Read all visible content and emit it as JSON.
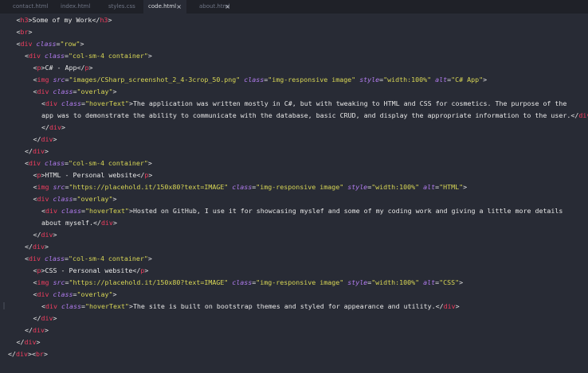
{
  "tabs": [
    {
      "label": "contact.html",
      "active": false
    },
    {
      "label": "index.html",
      "active": false
    },
    {
      "label": "styles.css",
      "active": false
    },
    {
      "label": "code.html",
      "active": true
    },
    {
      "label": "about.html",
      "active": false
    }
  ],
  "close_glyph": "×",
  "code_lines": [
    {
      "indent": 1,
      "tokens": [
        [
          "t",
          "<"
        ],
        [
          "tg",
          "h3"
        ],
        [
          "t",
          ">"
        ],
        [
          "tx",
          "Some of my Work"
        ],
        [
          "t",
          "</"
        ],
        [
          "tg",
          "h3"
        ],
        [
          "t",
          ">"
        ]
      ]
    },
    {
      "indent": 1,
      "tokens": [
        [
          "t",
          "<"
        ],
        [
          "tg",
          "br"
        ],
        [
          "t",
          ">"
        ]
      ]
    },
    {
      "indent": 1,
      "tokens": [
        [
          "t",
          "<"
        ],
        [
          "tg",
          "div"
        ],
        [
          "t",
          " "
        ],
        [
          "at",
          "class"
        ],
        [
          "eq",
          "="
        ],
        [
          "st",
          "\"row\""
        ],
        [
          "t",
          ">"
        ]
      ]
    },
    {
      "indent": 2,
      "tokens": [
        [
          "t",
          "<"
        ],
        [
          "tg",
          "div"
        ],
        [
          "t",
          " "
        ],
        [
          "at",
          "class"
        ],
        [
          "eq",
          "="
        ],
        [
          "st",
          "\"col-sm-4 container\""
        ],
        [
          "t",
          ">"
        ]
      ]
    },
    {
      "indent": 3,
      "tokens": [
        [
          "t",
          "<"
        ],
        [
          "tg",
          "p"
        ],
        [
          "t",
          ">"
        ],
        [
          "tx",
          "C# - App"
        ],
        [
          "t",
          "</"
        ],
        [
          "tg",
          "p"
        ],
        [
          "t",
          ">"
        ]
      ]
    },
    {
      "indent": 3,
      "tokens": [
        [
          "t",
          "<"
        ],
        [
          "tg",
          "img"
        ],
        [
          "t",
          " "
        ],
        [
          "at",
          "src"
        ],
        [
          "eq",
          "="
        ],
        [
          "st",
          "\"images/CSharp_screenshot_2_4-3crop_50.png\""
        ],
        [
          "t",
          " "
        ],
        [
          "at",
          "class"
        ],
        [
          "eq",
          "="
        ],
        [
          "st",
          "\"img-responsive image\""
        ],
        [
          "t",
          " "
        ],
        [
          "at",
          "style"
        ],
        [
          "eq",
          "="
        ],
        [
          "st",
          "\"width:100%\""
        ],
        [
          "t",
          " "
        ],
        [
          "at",
          "alt"
        ],
        [
          "eq",
          "="
        ],
        [
          "st",
          "\"C# App\""
        ],
        [
          "t",
          ">"
        ]
      ]
    },
    {
      "indent": 3,
      "tokens": [
        [
          "t",
          "<"
        ],
        [
          "tg",
          "div"
        ],
        [
          "t",
          " "
        ],
        [
          "at",
          "class"
        ],
        [
          "eq",
          "="
        ],
        [
          "st",
          "\"overlay\""
        ],
        [
          "t",
          ">"
        ]
      ]
    },
    {
      "indent": 4,
      "tokens": [
        [
          "t",
          "<"
        ],
        [
          "tg",
          "div"
        ],
        [
          "t",
          " "
        ],
        [
          "at",
          "class"
        ],
        [
          "eq",
          "="
        ],
        [
          "st",
          "\"hoverText\""
        ],
        [
          "t",
          ">"
        ],
        [
          "tx",
          "The application was written mostly in C#, but with tweaking to HTML and CSS for cosmetics. The purpose of the"
        ]
      ]
    },
    {
      "indent": 4,
      "tokens": [
        [
          "tx",
          "app was to demonstrate the ability to communicate with the database, basic CRUD, and display the appropriate information to the user."
        ],
        [
          "t",
          "</"
        ],
        [
          "tg",
          "div"
        ],
        [
          "t",
          ">"
        ]
      ]
    },
    {
      "indent": 4,
      "tokens": [
        [
          "t",
          "</"
        ],
        [
          "tg",
          "div"
        ],
        [
          "t",
          ">"
        ]
      ]
    },
    {
      "indent": 3,
      "tokens": [
        [
          "t",
          "</"
        ],
        [
          "tg",
          "div"
        ],
        [
          "t",
          ">"
        ]
      ]
    },
    {
      "indent": 2,
      "tokens": [
        [
          "t",
          "</"
        ],
        [
          "tg",
          "div"
        ],
        [
          "t",
          ">"
        ]
      ]
    },
    {
      "indent": 2,
      "tokens": [
        [
          "t",
          "<"
        ],
        [
          "tg",
          "div"
        ],
        [
          "t",
          " "
        ],
        [
          "at",
          "class"
        ],
        [
          "eq",
          "="
        ],
        [
          "st",
          "\"col-sm-4 container\""
        ],
        [
          "t",
          ">"
        ]
      ]
    },
    {
      "indent": 3,
      "tokens": [
        [
          "t",
          "<"
        ],
        [
          "tg",
          "p"
        ],
        [
          "t",
          ">"
        ],
        [
          "tx",
          "HTML - Personal website"
        ],
        [
          "t",
          "</"
        ],
        [
          "tg",
          "p"
        ],
        [
          "t",
          ">"
        ]
      ]
    },
    {
      "indent": 3,
      "tokens": [
        [
          "t",
          "<"
        ],
        [
          "tg",
          "img"
        ],
        [
          "t",
          " "
        ],
        [
          "at",
          "src"
        ],
        [
          "eq",
          "="
        ],
        [
          "st",
          "\"https://placehold.it/150x80?text=IMAGE\""
        ],
        [
          "t",
          " "
        ],
        [
          "at",
          "class"
        ],
        [
          "eq",
          "="
        ],
        [
          "st",
          "\"img-responsive image\""
        ],
        [
          "t",
          " "
        ],
        [
          "at",
          "style"
        ],
        [
          "eq",
          "="
        ],
        [
          "st",
          "\"width:100%\""
        ],
        [
          "t",
          " "
        ],
        [
          "at",
          "alt"
        ],
        [
          "eq",
          "="
        ],
        [
          "st",
          "\"HTML\""
        ],
        [
          "t",
          ">"
        ]
      ]
    },
    {
      "indent": 3,
      "tokens": [
        [
          "t",
          "<"
        ],
        [
          "tg",
          "div"
        ],
        [
          "t",
          " "
        ],
        [
          "at",
          "class"
        ],
        [
          "eq",
          "="
        ],
        [
          "st",
          "\"overlay\""
        ],
        [
          "t",
          ">"
        ]
      ]
    },
    {
      "indent": 4,
      "tokens": [
        [
          "t",
          "<"
        ],
        [
          "tg",
          "div"
        ],
        [
          "t",
          " "
        ],
        [
          "at",
          "class"
        ],
        [
          "eq",
          "="
        ],
        [
          "st",
          "\"hoverText\""
        ],
        [
          "t",
          ">"
        ],
        [
          "tx",
          "Hosted on GitHub, I use it for showcasing myslef and some of my coding work and giving a little more details"
        ]
      ]
    },
    {
      "indent": 4,
      "tokens": [
        [
          "tx",
          "about myself."
        ],
        [
          "t",
          "</"
        ],
        [
          "tg",
          "div"
        ],
        [
          "t",
          ">"
        ]
      ]
    },
    {
      "indent": 3,
      "tokens": [
        [
          "t",
          "</"
        ],
        [
          "tg",
          "div"
        ],
        [
          "t",
          ">"
        ]
      ]
    },
    {
      "indent": 2,
      "tokens": [
        [
          "t",
          "</"
        ],
        [
          "tg",
          "div"
        ],
        [
          "t",
          ">"
        ]
      ]
    },
    {
      "indent": 2,
      "tokens": [
        [
          "t",
          "<"
        ],
        [
          "tg",
          "div"
        ],
        [
          "t",
          " "
        ],
        [
          "at",
          "class"
        ],
        [
          "eq",
          "="
        ],
        [
          "st",
          "\"col-sm-4 container\""
        ],
        [
          "t",
          ">"
        ]
      ]
    },
    {
      "indent": 3,
      "tokens": [
        [
          "t",
          "<"
        ],
        [
          "tg",
          "p"
        ],
        [
          "t",
          ">"
        ],
        [
          "tx",
          "CSS - Personal website"
        ],
        [
          "t",
          "</"
        ],
        [
          "tg",
          "p"
        ],
        [
          "t",
          ">"
        ]
      ]
    },
    {
      "indent": 3,
      "tokens": [
        [
          "t",
          "<"
        ],
        [
          "tg",
          "img"
        ],
        [
          "t",
          " "
        ],
        [
          "at",
          "src"
        ],
        [
          "eq",
          "="
        ],
        [
          "st",
          "\"https://placehold.it/150x80?text=IMAGE\""
        ],
        [
          "t",
          " "
        ],
        [
          "at",
          "class"
        ],
        [
          "eq",
          "="
        ],
        [
          "st",
          "\"img-responsive image\""
        ],
        [
          "t",
          " "
        ],
        [
          "at",
          "style"
        ],
        [
          "eq",
          "="
        ],
        [
          "st",
          "\"width:100%\""
        ],
        [
          "t",
          " "
        ],
        [
          "at",
          "alt"
        ],
        [
          "eq",
          "="
        ],
        [
          "st",
          "\"CSS\""
        ],
        [
          "t",
          ">"
        ]
      ]
    },
    {
      "indent": 3,
      "tokens": [
        [
          "t",
          "<"
        ],
        [
          "tg",
          "div"
        ],
        [
          "t",
          " "
        ],
        [
          "at",
          "class"
        ],
        [
          "eq",
          "="
        ],
        [
          "st",
          "\"overlay\""
        ],
        [
          "t",
          ">"
        ]
      ]
    },
    {
      "indent": 4,
      "tokens": [
        [
          "t",
          "<"
        ],
        [
          "tg",
          "div"
        ],
        [
          "t",
          " "
        ],
        [
          "at",
          "class"
        ],
        [
          "eq",
          "="
        ],
        [
          "st",
          "\"hoverText\""
        ],
        [
          "t",
          ">"
        ],
        [
          "tx",
          "The site is built on bootstrap themes and styled for appearance and utility."
        ],
        [
          "t",
          "</"
        ],
        [
          "tg",
          "div"
        ],
        [
          "t",
          ">"
        ]
      ]
    },
    {
      "indent": 3,
      "tokens": [
        [
          "t",
          "</"
        ],
        [
          "tg",
          "div"
        ],
        [
          "t",
          ">"
        ]
      ]
    },
    {
      "indent": 2,
      "tokens": [
        [
          "t",
          "</"
        ],
        [
          "tg",
          "div"
        ],
        [
          "t",
          ">"
        ]
      ]
    },
    {
      "indent": 1,
      "tokens": [
        [
          "t",
          "</"
        ],
        [
          "tg",
          "div"
        ],
        [
          "t",
          ">"
        ]
      ]
    },
    {
      "indent": 0,
      "tokens": [
        [
          "t",
          "</"
        ],
        [
          "tg",
          "div"
        ],
        [
          "t",
          "><"
        ],
        [
          "tg",
          "br"
        ],
        [
          "t",
          ">"
        ]
      ]
    }
  ],
  "colors": {
    "background": "#282b35",
    "tabbar": "#1f2128",
    "tag": "#f03e5f",
    "attribute": "#b27cf0",
    "string": "#d8d655",
    "text": "#e6e6e6"
  }
}
